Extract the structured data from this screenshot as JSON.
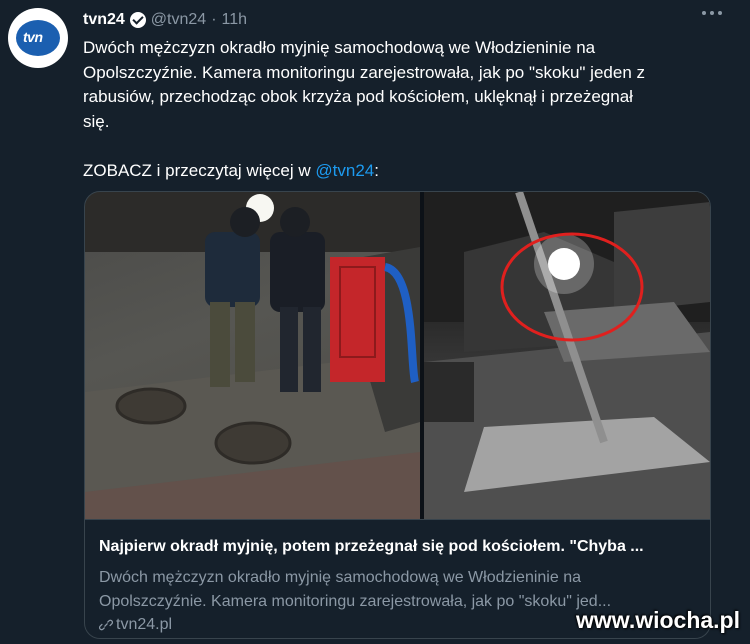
{
  "tweet": {
    "author_name": "tvn24",
    "handle": "@tvn24",
    "separator": "·",
    "time": "11h",
    "avatar_text": "tvn",
    "text_line1": "Dwóch mężczyzn okradło myjnię samochodową we Włodzieninie na",
    "text_line2": "Opolszczyźnie. Kamera monitoringu zarejestrowała, jak po \"skoku\" jeden z",
    "text_line3": "rabusiów, przechodząc obok krzyża pod kościołem, uklęknął i przeżegnał",
    "text_line4": "się.",
    "text_line5_prefix": "ZOBACZ i przeczytaj więcej w ",
    "text_line5_mention": "@tvn24",
    "text_line5_suffix": ":"
  },
  "card": {
    "title": "Najpierw okradł myjnię, potem przeżegnał się pod kościołem. \"Chyba ...",
    "desc_line1": "Dwóch mężczyzn okradło myjnię samochodową we Włodzieninie na",
    "desc_line2": "Opolszczyźnie. Kamera monitoringu zarejestrowała, jak po \"skoku\" jed...",
    "domain": "tvn24.pl"
  },
  "watermark": "www.wiocha.pl",
  "colors": {
    "background": "#15202b",
    "text": "#ffffff",
    "muted": "#8b98a5",
    "link": "#1d9bf0",
    "border": "#38444d",
    "annotation_circle": "#e0201e"
  },
  "icons": [
    "verified-badge-icon",
    "more-options-icon",
    "link-icon"
  ]
}
